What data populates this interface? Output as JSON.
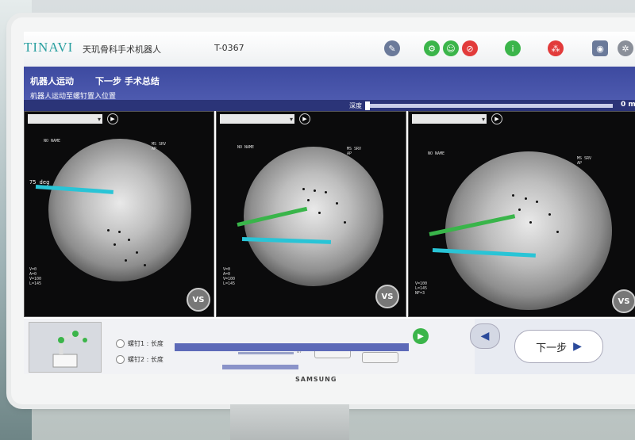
{
  "app": {
    "logo": "TINAVI",
    "system_name": "天玑骨科手术机器人",
    "case_id": "T-0367"
  },
  "toolbar": {
    "icons": [
      "wrench-icon",
      "robot-arm-icon",
      "person-icon",
      "no-entry-icon",
      "info-icon",
      "network-icon",
      "camera-icon",
      "gear-icon"
    ]
  },
  "header": {
    "current_step": "机器人运动",
    "next_step": "下一步 手术总结",
    "instruction": "机器人运动至螺钉置入位置"
  },
  "depth": {
    "label": "深度",
    "value": "0 m"
  },
  "panels": [
    {
      "view_select": "",
      "angle_label": "75 deg",
      "vs_label": "VS"
    },
    {
      "view_select": "",
      "vs_label": "VS"
    },
    {
      "view_select": "",
      "vs_label": "VS"
    }
  ],
  "screws": [
    {
      "label": "螺钉1 : 长度"
    },
    {
      "label": "螺钉2 : 长度"
    }
  ],
  "controls": {
    "slider_value": "87"
  },
  "navigation": {
    "prev_label": "◀",
    "next_label": "下一步",
    "next_arrow": "▶"
  },
  "monitor_brand": "SAMSUNG",
  "colors": {
    "header": "#3d4aa0",
    "accent_teal": "#2aa0a0",
    "go_green": "#3bb54a",
    "trajectory_green": "#39b54a",
    "trajectory_cyan": "#29c4d6"
  }
}
